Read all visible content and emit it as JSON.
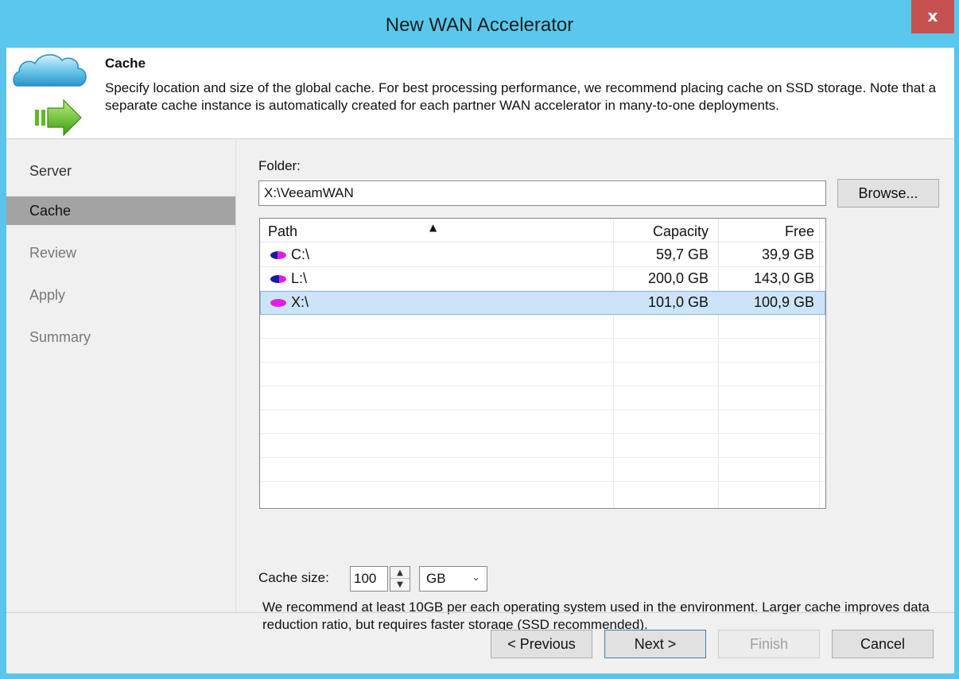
{
  "window": {
    "title": "New WAN Accelerator",
    "close_glyph": "x"
  },
  "header": {
    "icon": "cloud-arrow-icon",
    "title": "Cache",
    "description": "Specify location and size of the global cache. For best processing performance, we recommend placing cache on SSD storage. Note that a separate cache instance is automatically created for each partner WAN accelerator in many-to-one deployments."
  },
  "steps": [
    {
      "label": "Server",
      "state": "done"
    },
    {
      "label": "Cache",
      "state": "active"
    },
    {
      "label": "Review",
      "state": "pending"
    },
    {
      "label": "Apply",
      "state": "pending"
    },
    {
      "label": "Summary",
      "state": "pending"
    }
  ],
  "folder": {
    "label": "Folder:",
    "value": "X:\\VeeamWAN",
    "browse_label": "Browse..."
  },
  "table": {
    "columns": [
      "Path",
      "Capacity",
      "Free"
    ],
    "sort_glyph": "▲",
    "rows": [
      {
        "icon": "disk-icon",
        "path": "C:\\",
        "capacity": "59,7 GB",
        "free": "39,9 GB",
        "selected": false
      },
      {
        "icon": "disk-icon",
        "path": "L:\\",
        "capacity": "200,0 GB",
        "free": "143,0 GB",
        "selected": false
      },
      {
        "icon": "disk-icon",
        "path": "X:\\",
        "capacity": "101,0 GB",
        "free": "100,9 GB",
        "selected": true
      }
    ]
  },
  "cache": {
    "label": "Cache size:",
    "value": "100",
    "unit": "GB",
    "note": "We recommend at least 10GB per each operating system used in the environment. Larger cache improves data reduction ratio, but requires faster storage (SSD recommended)."
  },
  "buttons": {
    "previous": "< Previous",
    "next": "Next >",
    "finish": "Finish",
    "cancel": "Cancel"
  },
  "colors": {
    "titlebar": "#5ac8ec",
    "close": "#c75050",
    "selection": "#cce4f7",
    "disk_full": "#e020e0",
    "disk_used": "#1a1aa0"
  }
}
